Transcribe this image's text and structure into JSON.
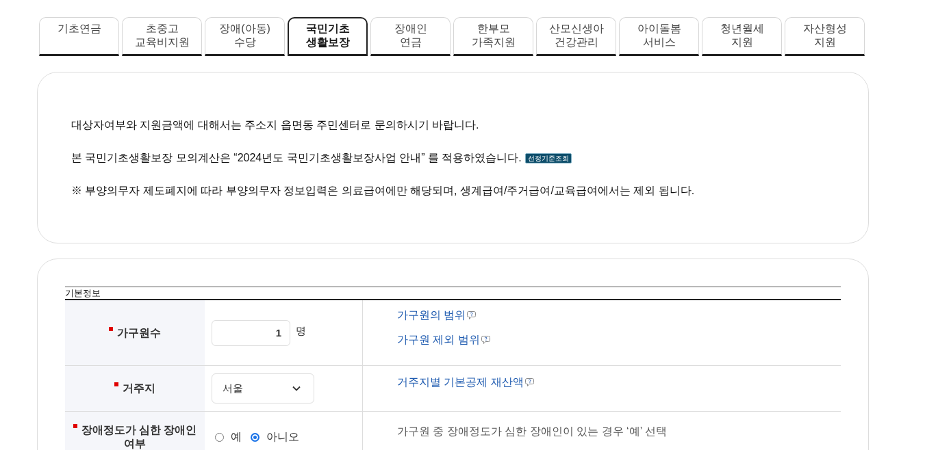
{
  "tabs": [
    {
      "label": "기초연금",
      "selected": false
    },
    {
      "label": "초중고\n교육비지원",
      "selected": false
    },
    {
      "label": "장애(아동)\n수당",
      "selected": false
    },
    {
      "label": "국민기초\n생활보장",
      "selected": true
    },
    {
      "label": "장애인\n연금",
      "selected": false
    },
    {
      "label": "한부모\n가족지원",
      "selected": false
    },
    {
      "label": "산모신생아\n건강관리",
      "selected": false
    },
    {
      "label": "아이돌봄\n서비스",
      "selected": false
    },
    {
      "label": "청년월세\n지원",
      "selected": false
    },
    {
      "label": "자산형성\n지원",
      "selected": false
    }
  ],
  "notice": {
    "paragraphs": [
      {
        "text": "대상자여부와 지원금액에 대해서는 주소지 읍면동 주민센터로 문의하시기 바랍니다."
      },
      {
        "text": "본 국민기초생활보장 모의계산은 “2024년도 국민기초생활보장사업 안내” 를 적용하였습니다.",
        "badge": "선정기준조회"
      },
      {
        "text": "※ 부양의무자 제도폐지에 따라 부양의무자 정보입력은 의료급여에만 해당되며, 생계급여/주거급여/교육급여에서는 제외 됩니다."
      }
    ]
  },
  "form": {
    "caption": "기본정보",
    "rows": [
      {
        "kind": "number",
        "label": "가구원수",
        "required": true,
        "value": "1",
        "unit": "명",
        "info": [
          {
            "kind": "link",
            "text": "가구원의 범위",
            "help": true
          },
          {
            "kind": "link",
            "text": "가구원 제외 범위",
            "help": true
          }
        ]
      },
      {
        "kind": "select",
        "label": "거주지",
        "required": true,
        "value": "서울",
        "info": [
          {
            "kind": "link",
            "text": "거주지별 기본공제 재산액",
            "help": true
          }
        ]
      },
      {
        "kind": "radio",
        "label": "장애정도가 심한 장애인 여부",
        "required": true,
        "options": [
          {
            "label": "예",
            "selected": false
          },
          {
            "label": "아니오",
            "selected": true
          }
        ],
        "info": [
          {
            "kind": "note",
            "text": "가구원 중 장애정도가 심한 장애인이 있는 경우 ‘예’ 선택"
          }
        ]
      }
    ]
  }
}
